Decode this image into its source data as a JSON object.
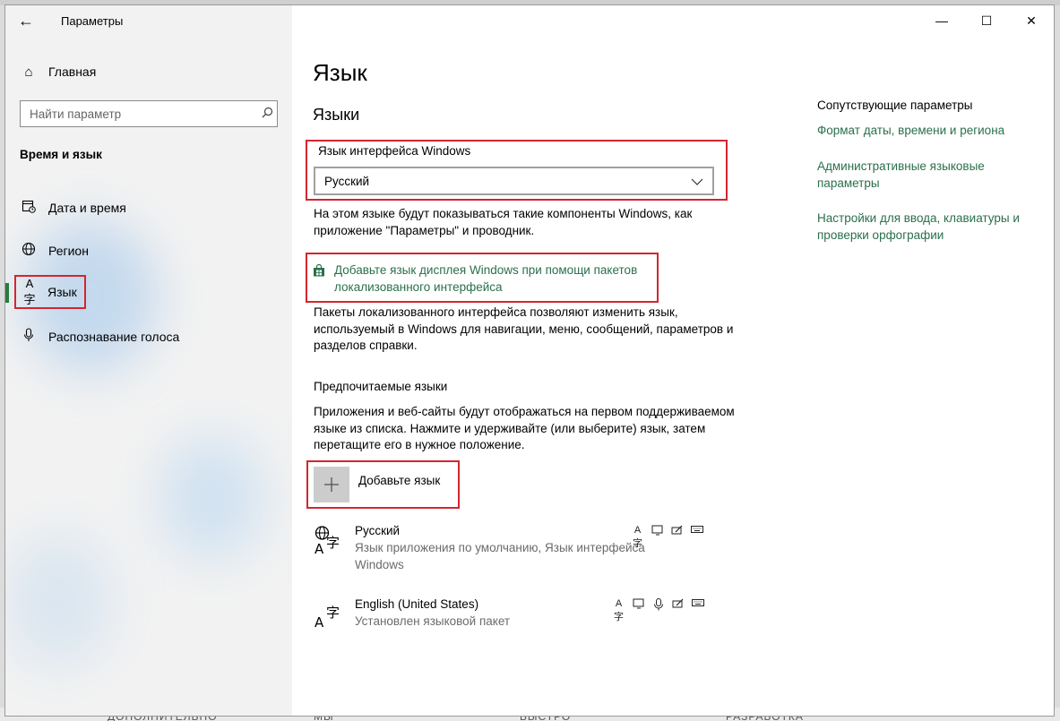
{
  "window": {
    "title": "Параметры",
    "controls": {
      "minimize": "—",
      "maximize": "☐",
      "close": "✕"
    }
  },
  "sidebar": {
    "home_label": "Главная",
    "search_placeholder": "Найти параметр",
    "section_title": "Время и язык",
    "items": [
      {
        "label": "Дата и время",
        "icon": "calendar-clock-icon"
      },
      {
        "label": "Регион",
        "icon": "globe-icon"
      },
      {
        "label": "Язык",
        "icon": "language-icon",
        "active": true
      },
      {
        "label": "Распознавание голоса",
        "icon": "microphone-icon"
      }
    ]
  },
  "main": {
    "page_title": "Язык",
    "languages_heading": "Языки",
    "display_language": {
      "label": "Язык интерфейса Windows",
      "selected": "Русский",
      "description": "На этом языке будут показываться такие компоненты Windows, как приложение \"Параметры\" и проводник."
    },
    "store_link": {
      "text": "Добавьте язык дисплея Windows при помощи пакетов локализованного интерфейса",
      "description": "Пакеты локализованного интерфейса позволяют изменить язык, используемый в Windows для навигации, меню, сообщений, параметров и разделов справки."
    },
    "preferred": {
      "title": "Предпочитаемые языки",
      "description": "Приложения и веб-сайты будут отображаться на первом поддерживаемом языке из списка. Нажмите и удерживайте (или выберите) язык, затем перетащите его в нужное положение.",
      "add_label": "Добавьте язык",
      "languages": [
        {
          "name": "Русский",
          "subtitle": "Язык приложения по умолчанию, Язык интерфейса Windows"
        },
        {
          "name": "English (United States)",
          "subtitle": "Установлен языковой пакет"
        }
      ]
    }
  },
  "related": {
    "title": "Сопутствующие параметры",
    "links": [
      "Формат даты, времени и региона",
      "Административные языковые параметры",
      "Настройки для ввода, клавиатуры и проверки орфографии"
    ]
  },
  "background": {
    "bottom_texts": [
      "ДОПОЛНИТЕЛЬНО",
      "МЫ",
      "БЫСТРО",
      "РАЗРАБОТКА"
    ]
  },
  "colors": {
    "accent_link": "#2a6f4d",
    "highlight_box": "#d3262f",
    "sidebar_bg": "#f2f2f2"
  }
}
